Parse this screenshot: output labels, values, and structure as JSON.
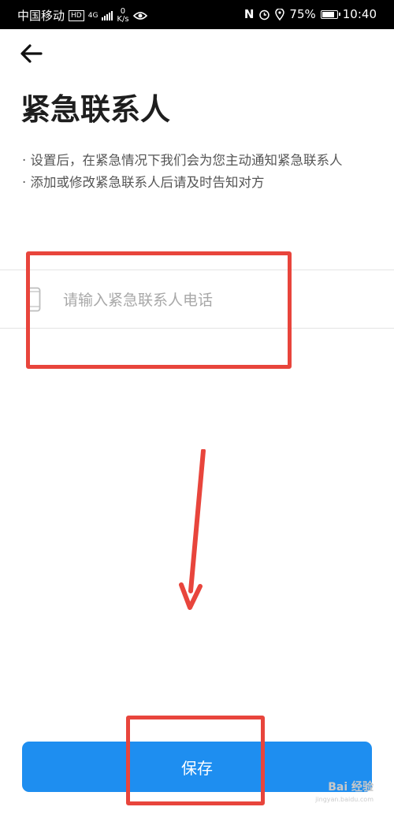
{
  "status_bar": {
    "carrier": "中国移动",
    "hd_badge": "HD",
    "network": "4G",
    "speed_value": "0",
    "speed_unit": "K/s",
    "nfc": "N",
    "battery": "75%",
    "time": "10:40"
  },
  "page": {
    "title": "紧急联系人",
    "tips": [
      "· 设置后，在紧急情况下我们会为您主动通知紧急联系人",
      "· 添加或修改紧急联系人后请及时告知对方"
    ]
  },
  "phone_input": {
    "value": "",
    "placeholder": "请输入紧急联系人电话"
  },
  "save_button": {
    "label": "保存"
  },
  "watermark": {
    "text": "Bai 经验",
    "sub": "jingyan.baidu.com"
  },
  "colors": {
    "accent": "#1e8ef0",
    "annotation": "#e8453c"
  }
}
